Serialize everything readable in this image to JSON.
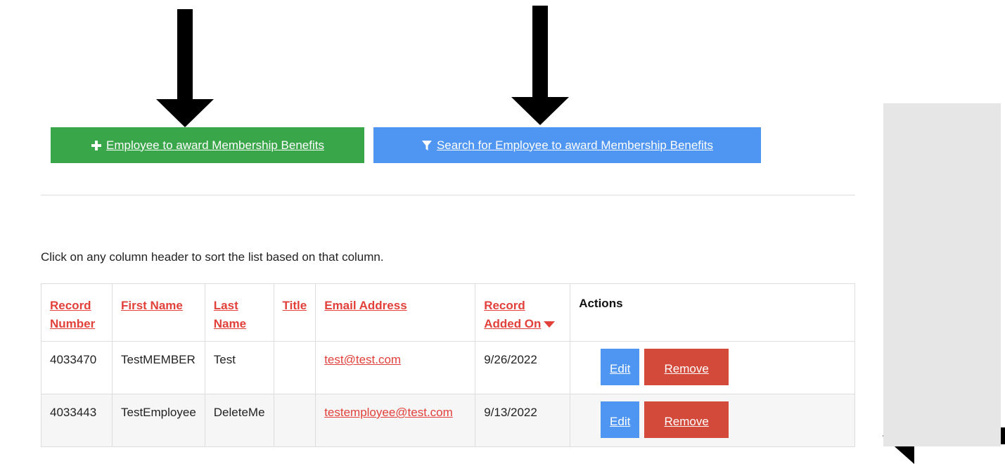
{
  "buttons": {
    "add_employee": "Employee to award Membership Benefits",
    "search_employee": "Search for Employee to award Membership Benefits"
  },
  "hint": "Click on any column header to sort the list based on that column.",
  "table": {
    "headers": {
      "record_number": "Record Number",
      "first_name": "First Name",
      "last_name": "Last Name",
      "title": "Title",
      "email": "Email Address",
      "added_on_line1": "Record",
      "added_on_line2": "Added On",
      "actions": "Actions"
    },
    "rows": [
      {
        "record": "4033470",
        "first": "TestMEMBER",
        "last": "Test",
        "title": "",
        "email": "test@test.com",
        "added": "9/26/2022",
        "edit": "Edit",
        "remove": "Remove"
      },
      {
        "record": "4033443",
        "first": "TestEmployee",
        "last": "DeleteMe",
        "title": "",
        "email": "testemployee@test.com",
        "added": "9/13/2022",
        "edit": "Edit",
        "remove": "Remove"
      }
    ]
  },
  "colors": {
    "green_button": "#3aa64a",
    "blue_button": "#4f95f2",
    "remove_button": "#d44a3a",
    "link_red": "#e2403a",
    "side_panel": "#e6e6e6"
  },
  "icons": {
    "add": "plus-icon",
    "search": "filter-icon",
    "sort": "caret-down-icon"
  }
}
